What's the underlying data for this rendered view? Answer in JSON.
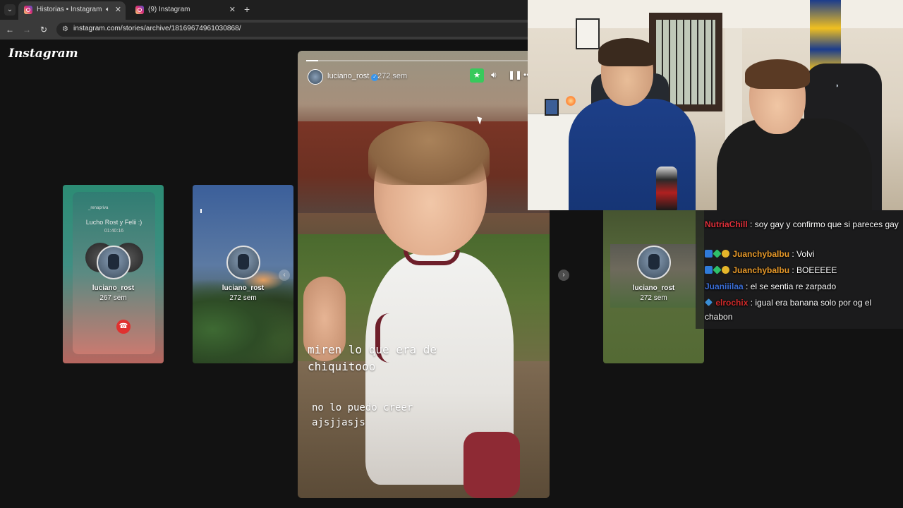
{
  "browser": {
    "tabs": [
      {
        "title": "Historias • Instagram",
        "active": true
      },
      {
        "title": "(9) Instagram",
        "active": false
      }
    ],
    "url": "instagram.com/stories/archive/18169674961030868/"
  },
  "instagram": {
    "logo": "Instagram",
    "side_cards": [
      {
        "name": "luciano_rost",
        "age": "267 sem",
        "call_title": "Lucho Rost  y Felii :)",
        "call_time": "01:40:16",
        "top_label": "_renapriva"
      },
      {
        "name": "luciano_rost",
        "age": "272 sem"
      },
      {
        "name": "luciano_rost",
        "age": "272 sem"
      }
    ],
    "story": {
      "username": "luciano_rost",
      "age": "272 sem",
      "progress": 0.05,
      "caption_1": "miren lo que era de\nchiquitooo",
      "caption_2": "no lo puedo creer\najsjjasjs"
    }
  },
  "chat": {
    "messages": [
      {
        "user": "NutriaChill",
        "user_color": "#e0303a",
        "text": "soy gay y confirmo que si pareces gay",
        "badges": []
      },
      {
        "user": "Juanchybalbu",
        "user_color": "#e89a2a",
        "text": "Volvi",
        "badges": [
          "mod",
          "star",
          "coin"
        ]
      },
      {
        "user": "Juanchybalbu",
        "user_color": "#e89a2a",
        "text": "BOEEEEE",
        "badges": [
          "mod",
          "star",
          "coin"
        ]
      },
      {
        "user": "Juaniiilaa",
        "user_color": "#3b6fd8",
        "text": "el se sentia re zarpado",
        "badges": []
      },
      {
        "user": "elrochix",
        "user_color": "#d02a2a",
        "text": "igual era banana solo por og el chabon",
        "badges": [
          "cube"
        ]
      }
    ]
  },
  "colors": {
    "browser_tabbar": "#1f1f1f",
    "browser_active_tab": "#3a3a3a",
    "page_bg": "#121212",
    "favorite_green": "#38c95c",
    "hangup_red": "#e0312f"
  }
}
